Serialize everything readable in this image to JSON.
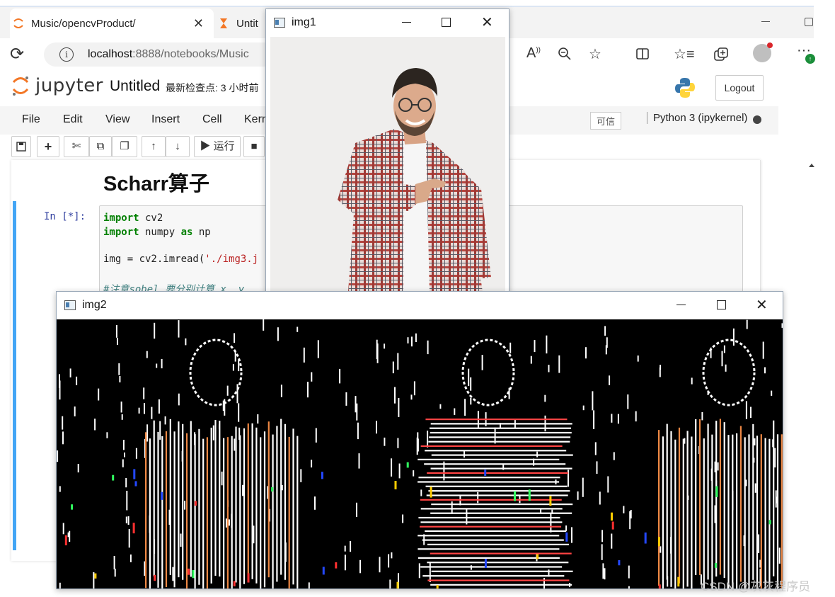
{
  "browser": {
    "tabs": [
      {
        "title": "Music/opencvProduct/",
        "close": "✕"
      },
      {
        "title": "Untit"
      }
    ],
    "url_host": "localhost",
    "url_rest": ":8888/notebooks/Music",
    "info_glyph": "i"
  },
  "jupyter": {
    "logo_text": "jupyter",
    "notebook_title": "Untitled",
    "checkpoint": "最新检查点: 3 小时前",
    "logout": "Logout",
    "menus": [
      "File",
      "Edit",
      "View",
      "Insert",
      "Cell",
      "Kern"
    ],
    "trusted": "可信",
    "kernel": "Python 3 (ipykernel)",
    "run_label": "▶ 运行"
  },
  "notebook": {
    "heading": "Scharr算子",
    "prompt": "In  [*]:",
    "code_lines": [
      {
        "parts": [
          [
            "kw",
            "import"
          ],
          [
            "",
            " cv2"
          ]
        ]
      },
      {
        "parts": [
          [
            "kw",
            "import"
          ],
          [
            "",
            " numpy "
          ],
          [
            "kw",
            "as"
          ],
          [
            "",
            " np"
          ]
        ]
      },
      {
        "parts": [
          [
            "",
            "img = cv2.imread("
          ],
          [
            "str",
            "'./img3.j"
          ]
        ]
      },
      {
        "parts": [
          [
            "cm",
            "#注意sobel 要分别计算 x ,y"
          ]
        ]
      }
    ]
  },
  "windows": {
    "img1": {
      "title": "img1"
    },
    "img2": {
      "title": "img2"
    }
  },
  "watermark": "CSDN @灰灰程序员",
  "colors": {
    "cell_border": "#42a5f5",
    "keyword": "#008000",
    "string": "#ba2121",
    "comment": "#408080",
    "python_blue": "#3776ab",
    "python_yellow": "#ffd43b",
    "jupyter_orange": "#f37726"
  },
  "icons": [
    "reload-icon",
    "info-icon",
    "read-aloud-icon",
    "zoom-icon",
    "favorite-icon",
    "split-screen-icon",
    "favorites-icon",
    "collections-icon",
    "more-icon",
    "save-icon",
    "add-cell-icon",
    "cut-icon",
    "copy-icon",
    "paste-icon",
    "move-up-icon",
    "move-down-icon",
    "stop-icon"
  ]
}
